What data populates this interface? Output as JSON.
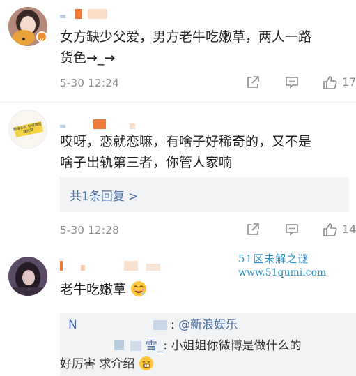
{
  "comments": [
    {
      "text_line1": "女方缺少父爱，男方老牛吃嫩草，两人一路",
      "text_line2": "货色→_→",
      "time": "5-30 12:24",
      "likes": "17"
    },
    {
      "avatar_text": "超级心机 你说我是 我就是",
      "text_line1": "哎呀，恋就恋嘛，有啥子好稀奇的，又不是",
      "text_line2": "啥子出轨第三者，你管人家喃",
      "reply_link": "共1条回复 >",
      "time": "5-30 12:28",
      "likes": "14"
    },
    {
      "text_line1": "老牛吃嫩草",
      "sub_replies": [
        {
          "user_initial": "N",
          "tail": ": ",
          "mention": "@新浪娱乐"
        },
        {
          "user_tail": "雪_",
          "text": ": 小姐姐你微博是做什么的",
          "text2": "好厉害 求介绍"
        }
      ]
    }
  ],
  "watermark": {
    "cn": "51区未解之谜",
    "url": "www.51qumi.com"
  },
  "colors": {
    "link": "#4a6fa5",
    "meta": "#8c8c8c",
    "watermark": "#2a93c9",
    "orange": "#f07a38"
  }
}
